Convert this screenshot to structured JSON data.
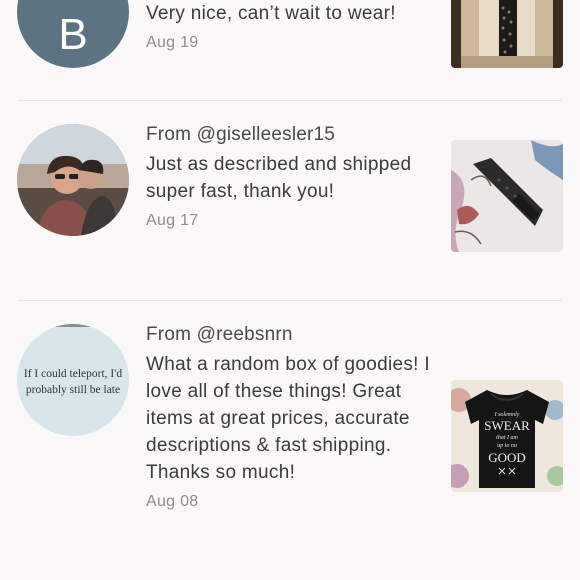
{
  "reviews": [
    {
      "avatar_letter": "B",
      "avatar_color": "#5b7382",
      "body": "Very nice, can’t wait to wear!",
      "date": "Aug 19",
      "product_icon": "watch-in-box-icon"
    },
    {
      "from": "From @giselleesler15",
      "body": "Just as described and shipped super fast, thank you!",
      "date": "Aug 17",
      "avatar_icon": "couple-photo-avatar",
      "product_icon": "black-watch-band-icon"
    },
    {
      "from": "From @reebsnrn",
      "avatar_quote": "If I could teleport, I'd probably still be late",
      "body": "What a random box of goodies! I love all of these things! Great items at great prices, accurate descriptions & fast shipping. Thanks so much!",
      "date": "Aug 08",
      "product_icon": "black-tshirt-icon",
      "product_shirt_text": [
        "I solemnly",
        "SWEAR",
        "that I am",
        "up to no",
        "GOOD"
      ]
    }
  ],
  "colors": {
    "background": "#fbf8fa",
    "divider": "#e9e4e7",
    "date": "#8e8a8c"
  }
}
